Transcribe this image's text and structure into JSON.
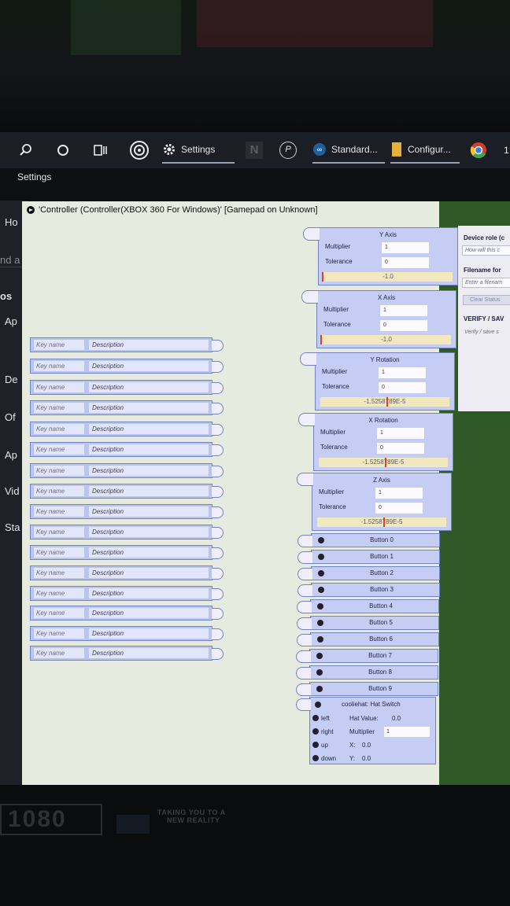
{
  "taskbar": {
    "settings_label": "Settings",
    "apps": [
      {
        "label": "Standard..."
      },
      {
        "label": "Configur..."
      }
    ],
    "n_icon_text": "N",
    "p_icon_text": "P",
    "edge_digit": "1"
  },
  "settings_header": "Settings",
  "left_fragments": [
    "Ho",
    "nd a",
    "os",
    "Ap",
    "De",
    "Of",
    "Ap",
    "Vid",
    "Sta"
  ],
  "window": {
    "title": "'Controller (Controller(XBOX 360 For Windows)' [Gamepad on Unknown]"
  },
  "key_rows": [
    {
      "key": "Key name",
      "desc": "Description"
    },
    {
      "key": "Key name",
      "desc": "Description"
    },
    {
      "key": "Key name",
      "desc": "Description"
    },
    {
      "key": "Key name",
      "desc": "Description"
    },
    {
      "key": "Key name",
      "desc": "Description"
    },
    {
      "key": "Key name",
      "desc": "Description"
    },
    {
      "key": "Key name",
      "desc": "Description"
    },
    {
      "key": "Key name",
      "desc": "Description"
    },
    {
      "key": "Key name",
      "desc": "Description"
    },
    {
      "key": "Key name",
      "desc": "Description"
    },
    {
      "key": "Key name",
      "desc": "Description"
    },
    {
      "key": "Key name",
      "desc": "Description"
    },
    {
      "key": "Key name",
      "desc": "Description"
    },
    {
      "key": "Key name",
      "desc": "Description"
    },
    {
      "key": "Key name",
      "desc": "Description"
    },
    {
      "key": "Key name",
      "desc": "Description"
    }
  ],
  "axes": [
    {
      "title": "Y Axis",
      "multiplier_label": "Multiplier",
      "multiplier": "1",
      "tolerance_label": "Tolerance",
      "tolerance": "0",
      "value": "-1.0"
    },
    {
      "title": "X Axis",
      "multiplier_label": "Multiplier",
      "multiplier": "1",
      "tolerance_label": "Tolerance",
      "tolerance": "0",
      "value": "-1.0"
    },
    {
      "title": "Y Rotation",
      "multiplier_label": "Multiplier",
      "multiplier": "1",
      "tolerance_label": "Tolerance",
      "tolerance": "0",
      "value": "-1.5258789E-5"
    },
    {
      "title": "X Rotation",
      "multiplier_label": "Multiplier",
      "multiplier": "1",
      "tolerance_label": "Tolerance",
      "tolerance": "0",
      "value": "-1.5258789E-5"
    },
    {
      "title": "Z Axis",
      "multiplier_label": "Multiplier",
      "multiplier": "1",
      "tolerance_label": "Tolerance",
      "tolerance": "0",
      "value": "-1.5258789E-5"
    }
  ],
  "buttons": [
    "Button 0",
    "Button 1",
    "Button 2",
    "Button 3",
    "Button 4",
    "Button 5",
    "Button 6",
    "Button 7",
    "Button 8",
    "Button 9"
  ],
  "hat": {
    "title": "cooliehat: Hat Switch",
    "dirs": [
      "left",
      "right",
      "up",
      "down"
    ],
    "hat_value_label": "Hat Value:",
    "hat_value": "0.0",
    "multiplier_label": "Multiplier",
    "multiplier": "1",
    "x_label": "X:",
    "x_value": "0.0",
    "y_label": "Y:",
    "y_value": "0.0"
  },
  "side_panel": {
    "device_role": "Device role (c",
    "how_placeholder": "How will this c",
    "filename_label": "Filename for",
    "filename_placeholder": "Enter a filenam",
    "clear_status": "Clear Status",
    "verify_label": "VERIFY / SAV",
    "verify_text": "Verify / save s"
  },
  "bottom": {
    "logo": "1080",
    "tagline_1": "TAKING YOU TO A",
    "tagline_2": "NEW REALITY"
  }
}
